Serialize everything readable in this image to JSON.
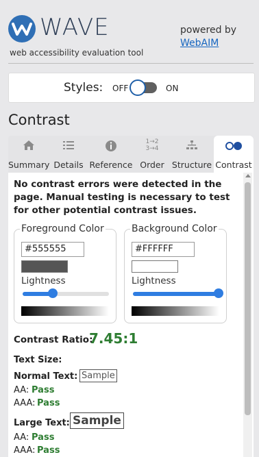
{
  "header": {
    "logo_text": "WAVE",
    "tagline": "web accessibility evaluation tool",
    "powered_by": "powered by",
    "webaim_link": "WebAIM"
  },
  "styles": {
    "label": "Styles:",
    "off": "OFF",
    "on": "ON",
    "enabled": true
  },
  "section_title": "Contrast",
  "tabs": [
    {
      "label": "Summary",
      "icon": "home-icon",
      "glyph": "⌂"
    },
    {
      "label": "Details",
      "icon": "list-icon",
      "glyph": "☰"
    },
    {
      "label": "Reference",
      "icon": "info-icon",
      "glyph": "ⓘ"
    },
    {
      "label": "Order",
      "icon": "order-icon",
      "glyph": "1→2\n3→4"
    },
    {
      "label": "Structure",
      "icon": "structure-icon",
      "glyph": "⊥"
    },
    {
      "label": "Contrast",
      "icon": "contrast-icon",
      "glyph": "○●",
      "active": true
    }
  ],
  "message": "No contrast errors were detected in the page. Manual testing is necessary to test for other potential contrast issues.",
  "foreground": {
    "legend": "Foreground Color",
    "hex": "#555555",
    "lightness_label": "Lightness",
    "lightness": 0.35
  },
  "background": {
    "legend": "Background Color",
    "hex": "#FFFFFF",
    "lightness_label": "Lightness",
    "lightness": 1.0
  },
  "ratio_label": "Contrast Ratio:",
  "ratio_value": "7.45:1",
  "text_size_label": "Text Size:",
  "normal_text_label": "Normal Text:",
  "large_text_label": "Large Text:",
  "sample": "Sample",
  "aa_label": "AA:",
  "aaa_label": "AAA:",
  "normal": {
    "aa": "Pass",
    "aaa": "Pass"
  },
  "large": {
    "aa": "Pass",
    "aaa": "Pass"
  },
  "colors": {
    "brand": "#2f3f57",
    "accent": "#2f7de1",
    "pass": "#2e7d32"
  }
}
